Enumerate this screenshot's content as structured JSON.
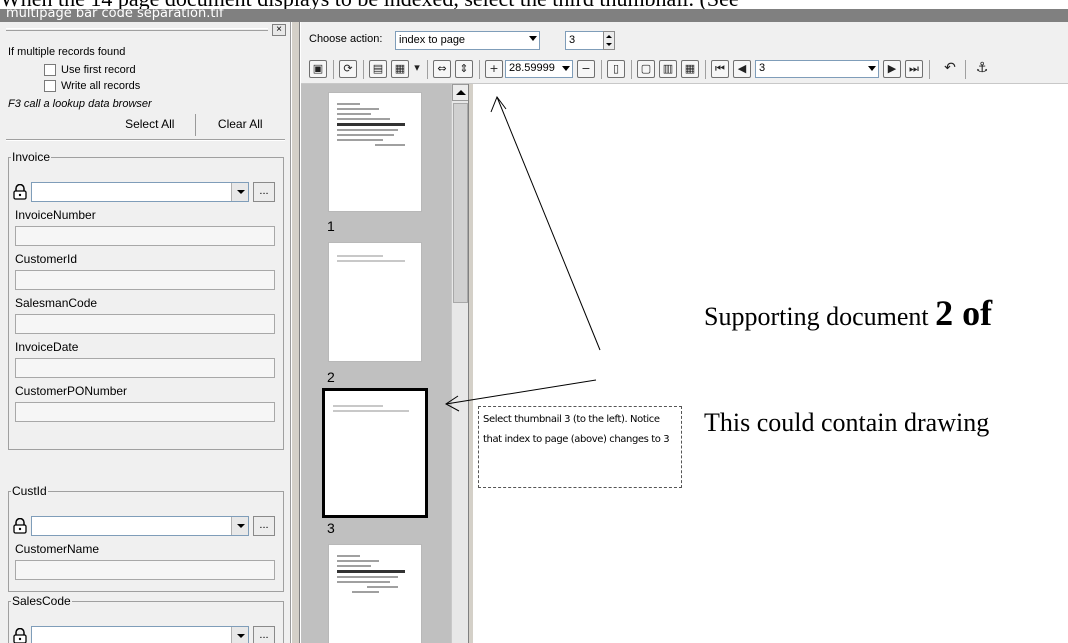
{
  "page": {
    "top_cut_text": "When the 14 page document displays to be indexed, select the third thumbnail. (See"
  },
  "window": {
    "title": "multipage bar code separation.tif"
  },
  "left_panel": {
    "close_glyph": "×",
    "options_title": "If multiple records found",
    "use_first_record": "Use first record",
    "write_all_records": "Write all records",
    "f3_note": "F3 call a lookup data browser",
    "select_all": "Select All",
    "clear_all": "Clear All",
    "groups": [
      {
        "legend": "Invoice",
        "fields": [
          "InvoiceNumber",
          "CustomerId",
          "SalesmanCode",
          "InvoiceDate",
          "CustomerPONumber"
        ]
      },
      {
        "legend": "CustId",
        "fields": [
          "CustomerName"
        ]
      },
      {
        "legend": "SalesCode",
        "fields": []
      }
    ],
    "dots_label": "..."
  },
  "toolbar": {
    "choose_action_label": "Choose action:",
    "action_value": "index to page",
    "page_spin_value": "3",
    "zoom_value": "28.59999",
    "nav_page_value": "3"
  },
  "thumbnails": {
    "labels": [
      "1",
      "2",
      "3"
    ],
    "selected_index": 3
  },
  "viewer": {
    "line1_text": "Supporting document ",
    "line1_bold": "2 of",
    "line2_text": "This could contain drawing"
  },
  "callout": {
    "text": "Select thumbnail 3 (to the left).  Notice that index to page (above) changes to 3"
  },
  "colors": {
    "title_bar": "#808080",
    "panel_bg": "#f0f0f0",
    "thumb_strip": "#c0c0c0"
  }
}
